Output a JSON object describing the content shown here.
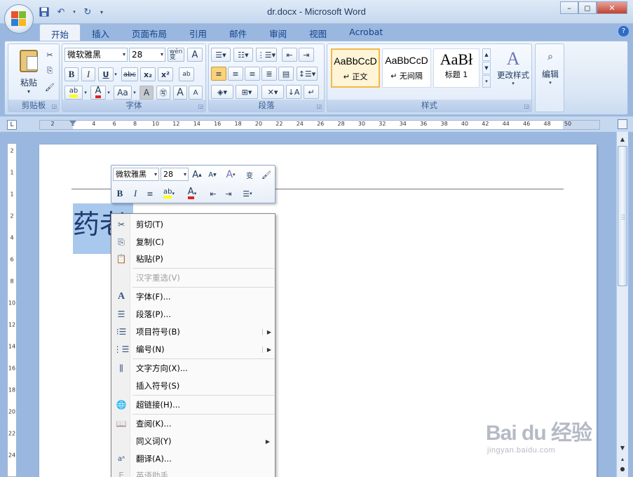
{
  "window": {
    "title": "dr.docx - Microsoft Word",
    "minimize": "–",
    "restore": "◻",
    "close": "✕"
  },
  "tabs": [
    {
      "label": "开始"
    },
    {
      "label": "插入"
    },
    {
      "label": "页面布局"
    },
    {
      "label": "引用"
    },
    {
      "label": "邮件"
    },
    {
      "label": "审阅"
    },
    {
      "label": "视图"
    },
    {
      "label": "Acrobat"
    }
  ],
  "ribbon": {
    "clipboard": {
      "label": "剪贴板",
      "paste": "粘贴"
    },
    "font": {
      "label": "字体",
      "font_name": "微软雅黑",
      "font_size": "28",
      "phonetic": "wén\n变",
      "bold": "B",
      "italic": "I",
      "underline": "U",
      "strike": "abc",
      "subscript": "x₂",
      "superscript": "x²",
      "change_case": "Aa",
      "grow": "A",
      "shrink": "A"
    },
    "paragraph": {
      "label": "段落"
    },
    "styles": {
      "label": "样式",
      "items": [
        {
          "sample": "AaBbCcD",
          "name": "↵ 正文"
        },
        {
          "sample": "AaBbCcD",
          "name": "↵ 无间隔"
        },
        {
          "sample": "AaBł",
          "name": "标题 1"
        }
      ],
      "change_styles": "更改样式"
    },
    "editing": {
      "label": "编辑"
    }
  },
  "ruler": {
    "corner": "L",
    "h_ticks": [
      "2",
      "2",
      "4",
      "6",
      "8",
      "10",
      "12",
      "14",
      "16",
      "18",
      "20",
      "22",
      "24",
      "26",
      "28",
      "30",
      "32",
      "34",
      "36",
      "38",
      "40",
      "42",
      "44",
      "46",
      "48",
      "50"
    ],
    "v_ticks": [
      "2",
      "1",
      "1",
      "2",
      "4",
      "6",
      "8",
      "10",
      "12",
      "14",
      "16",
      "18",
      "20",
      "22",
      "24"
    ]
  },
  "document": {
    "text": "药老"
  },
  "mini_toolbar": {
    "font_name": "微软雅黑",
    "font_size": "28",
    "bold": "B",
    "italic": "I"
  },
  "context_menu": [
    {
      "label": "剪切(T)",
      "icon": "scissors-icon",
      "disabled": false
    },
    {
      "label": "复制(C)",
      "icon": "copy-icon",
      "disabled": false
    },
    {
      "label": "粘贴(P)",
      "icon": "paste-icon",
      "disabled": false
    },
    {
      "label": "汉字重选(V)",
      "icon": "",
      "disabled": true
    },
    {
      "label": "字体(F)...",
      "icon": "font-icon",
      "disabled": false
    },
    {
      "label": "段落(P)...",
      "icon": "paragraph-icon",
      "disabled": false
    },
    {
      "label": "项目符号(B)",
      "icon": "bullets-icon",
      "disabled": false
    },
    {
      "label": "编号(N)",
      "icon": "numbering-icon",
      "disabled": false
    },
    {
      "label": "文字方向(X)...",
      "icon": "text-direction-icon",
      "disabled": false
    },
    {
      "label": "插入符号(S)",
      "icon": "",
      "disabled": false
    },
    {
      "label": "超链接(H)...",
      "icon": "hyperlink-icon",
      "disabled": false
    },
    {
      "label": "查阅(K)...",
      "icon": "lookup-icon",
      "disabled": false
    },
    {
      "label": "同义词(Y)",
      "icon": "",
      "disabled": false
    },
    {
      "label": "翻译(A)...",
      "icon": "translate-icon",
      "disabled": false
    },
    {
      "label": "英语助手",
      "icon": "english-assistant-icon",
      "disabled": true
    }
  ],
  "watermark": {
    "main": "Bai du 经验",
    "sub": "jingyan.baidu.com"
  }
}
